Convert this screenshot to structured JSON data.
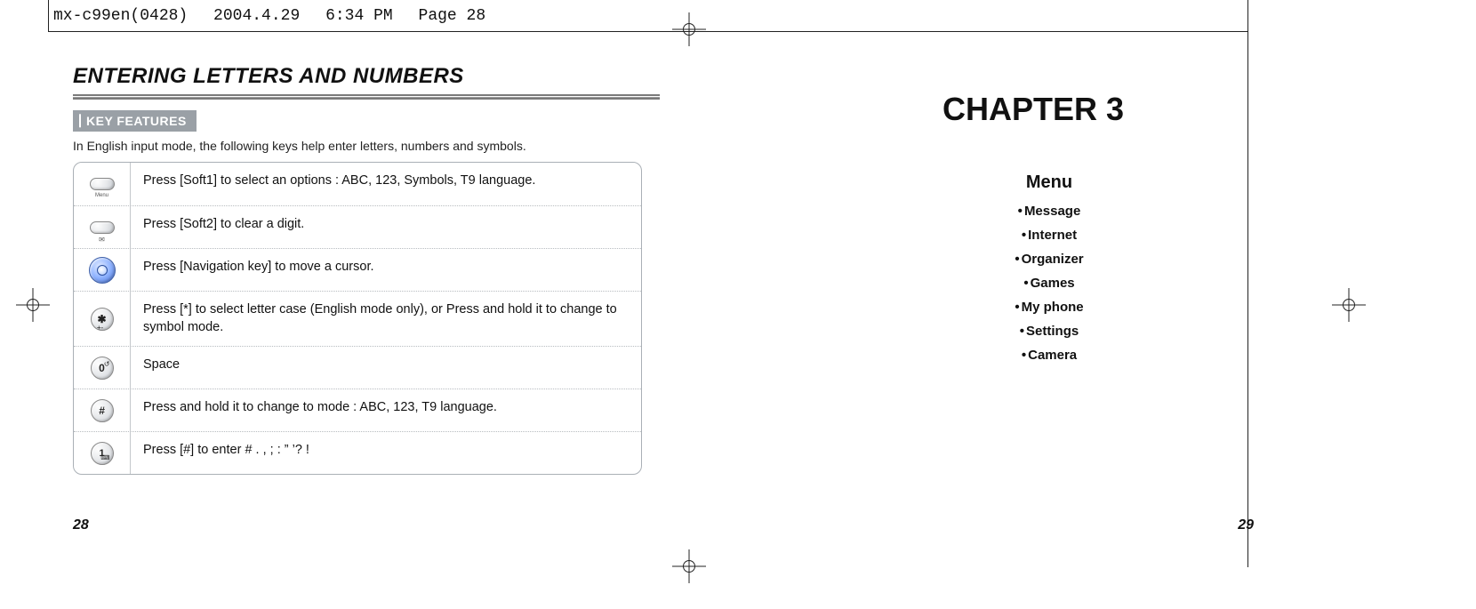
{
  "file_header": {
    "filename": "mx-c99en(0428)",
    "date": "2004.4.29",
    "time": "6:34 PM",
    "page": "Page 28"
  },
  "left_page": {
    "title": "ENTERING LETTERS AND NUMBERS",
    "section_label": "KEY FEATURES",
    "intro": "In English input mode, the following keys help enter letters, numbers and symbols.",
    "rows": [
      {
        "icon": "soft1-menu-key-icon",
        "desc": "Press [Soft1] to select an options : ABC, 123, Symbols, T9 language."
      },
      {
        "icon": "soft2-clear-key-icon",
        "desc": "Press [Soft2] to clear a digit."
      },
      {
        "icon": "navigation-key-icon",
        "desc": "Press [Navigation key] to move a cursor."
      },
      {
        "icon": "star-key-icon",
        "desc": "Press [*] to select letter case (English mode only), or Press and hold it to change to symbol mode."
      },
      {
        "icon": "zero-key-icon",
        "desc": "Space"
      },
      {
        "icon": "hash-key-icon",
        "desc": "Press and hold it to change to mode : ABC, 123, T9 language."
      },
      {
        "icon": "one-key-icon",
        "desc": "Press [#] to enter  # . , ; : ” ’? !"
      }
    ],
    "page_number": "28"
  },
  "right_page": {
    "chapter": "CHAPTER 3",
    "menu_title": "Menu",
    "menu_items": [
      "Message",
      "Internet",
      "Organizer",
      "Games",
      "My phone",
      "Settings",
      "Camera"
    ],
    "page_number": "29"
  }
}
